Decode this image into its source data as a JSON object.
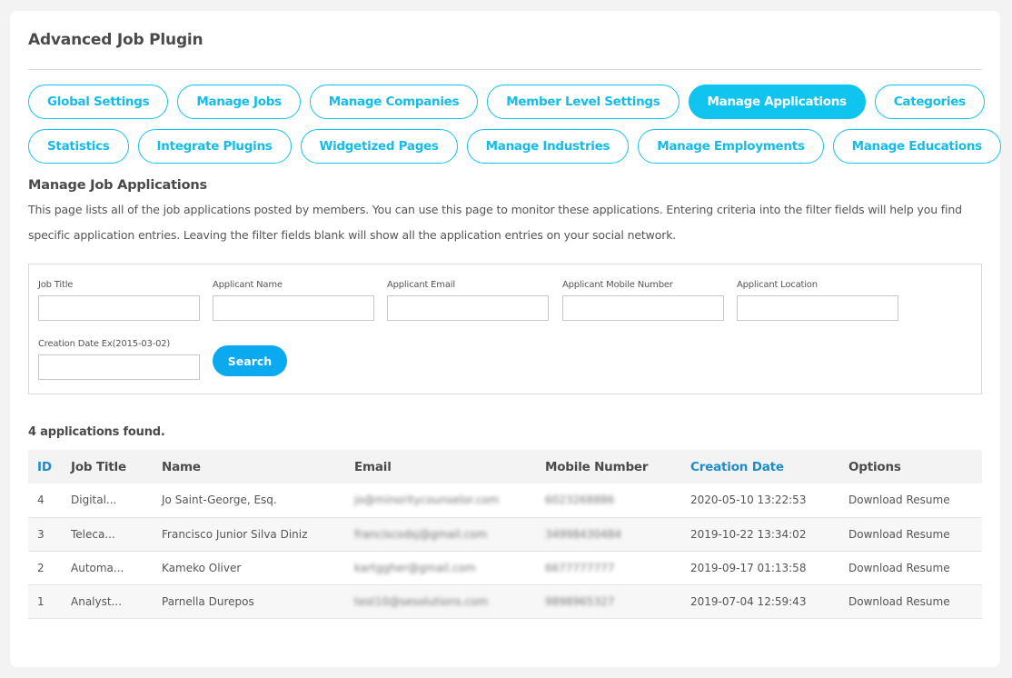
{
  "header": {
    "title": "Advanced Job Plugin"
  },
  "nav": {
    "row1": [
      {
        "label": "Global Settings",
        "active": false
      },
      {
        "label": "Manage Jobs",
        "active": false
      },
      {
        "label": "Manage Companies",
        "active": false
      },
      {
        "label": "Member Level Settings",
        "active": false
      },
      {
        "label": "Manage Applications",
        "active": true
      },
      {
        "label": "Categories",
        "active": false
      }
    ],
    "row2": [
      {
        "label": "Statistics",
        "active": false
      },
      {
        "label": "Integrate Plugins",
        "active": false
      },
      {
        "label": "Widgetized Pages",
        "active": false
      },
      {
        "label": "Manage Industries",
        "active": false
      },
      {
        "label": "Manage Employments",
        "active": false
      },
      {
        "label": "Manage Educations",
        "active": false
      }
    ]
  },
  "section": {
    "title": "Manage Job Applications",
    "description": "This page lists all of the job applications posted by members. You can use this page to monitor these applications. Entering criteria into the filter fields will help you find specific application entries. Leaving the filter fields blank will show all the application entries on your social network."
  },
  "filters": {
    "job_title": {
      "label": "Job Title",
      "value": ""
    },
    "applicant_name": {
      "label": "Applicant Name",
      "value": ""
    },
    "applicant_email": {
      "label": "Applicant Email",
      "value": ""
    },
    "applicant_mobile": {
      "label": "Applicant Mobile Number",
      "value": ""
    },
    "applicant_location": {
      "label": "Applicant Location",
      "value": ""
    },
    "creation_date": {
      "label": "Creation Date Ex(2015-03-02)",
      "value": ""
    },
    "search_label": "Search"
  },
  "results": {
    "count_text": "4 applications found.",
    "columns": [
      "ID",
      "Job Title",
      "Name",
      "Email",
      "Mobile Number",
      "Creation Date",
      "Options"
    ],
    "rows": [
      {
        "id": "4",
        "job_title": "Digital...",
        "name": "Jo Saint-George, Esq.",
        "email": "jo@minoritycounselor.com",
        "mobile": "6023268886",
        "created": "2020-05-10 13:22:53",
        "option": "Download Resume"
      },
      {
        "id": "3",
        "job_title": "Teleca...",
        "name": "Francisco Junior Silva Diniz",
        "email": "franciscodsj@gmail.com",
        "mobile": "34998430484",
        "created": "2019-10-22 13:34:02",
        "option": "Download Resume"
      },
      {
        "id": "2",
        "job_title": "Automa...",
        "name": "Kameko Oliver",
        "email": "kartggher@gmail.com",
        "mobile": "6677777777",
        "created": "2019-09-17 01:13:58",
        "option": "Download Resume"
      },
      {
        "id": "1",
        "job_title": "Analyst...",
        "name": "Parnella Durepos",
        "email": "test10@sesolutions.com",
        "mobile": "9898965327",
        "created": "2019-07-04 12:59:43",
        "option": "Download Resume"
      }
    ]
  }
}
